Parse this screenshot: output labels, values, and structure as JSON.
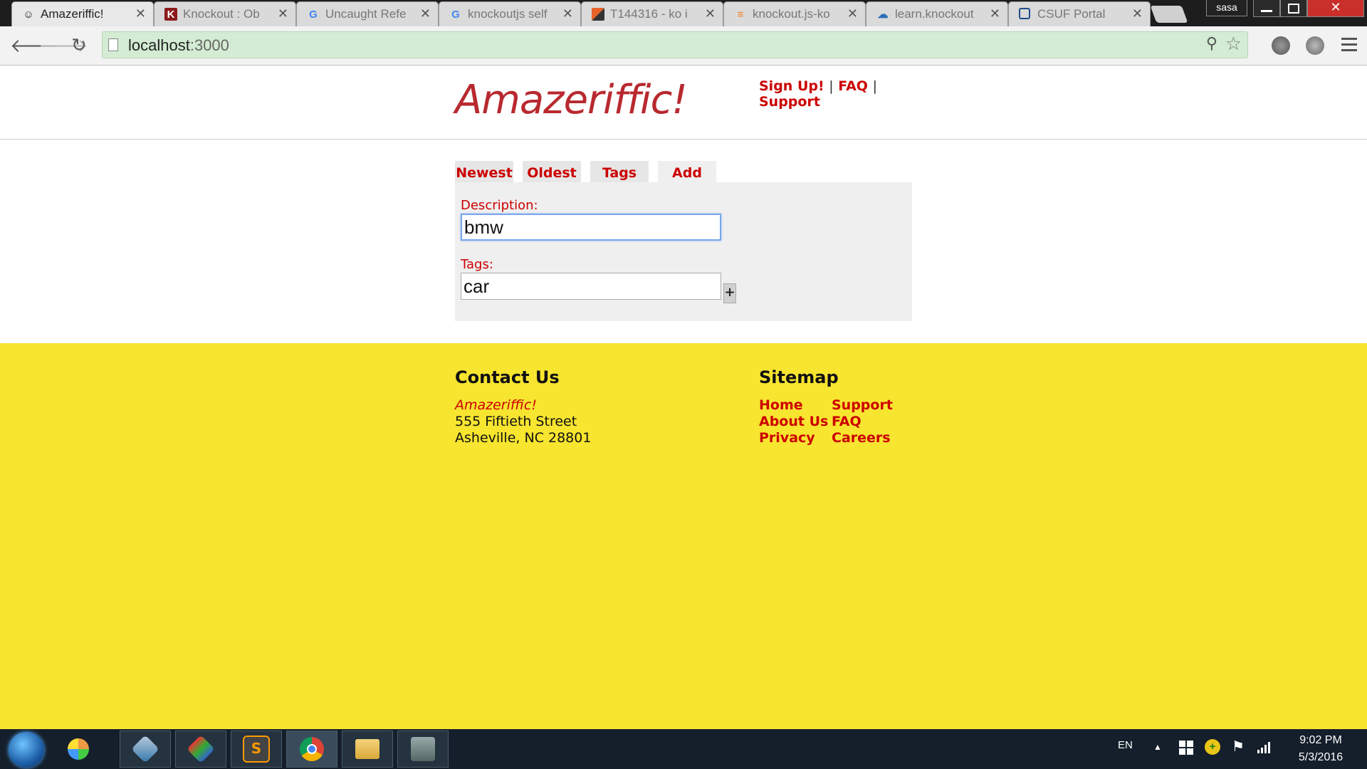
{
  "browser": {
    "tabs": [
      {
        "title": "Amazeriffic!",
        "active": true,
        "icon": "smiley-icon"
      },
      {
        "title": "Knockout : Ob",
        "active": false,
        "icon": "knockout-icon"
      },
      {
        "title": "Uncaught Refe",
        "active": false,
        "icon": "google-icon"
      },
      {
        "title": "knockoutjs self",
        "active": false,
        "icon": "google-icon"
      },
      {
        "title": "T144316 - ko i",
        "active": false,
        "icon": "phabricator-icon"
      },
      {
        "title": "knockout.js-ko",
        "active": false,
        "icon": "stackoverflow-icon"
      },
      {
        "title": "learn.knockout",
        "active": false,
        "icon": "cloud-icon"
      },
      {
        "title": "CSUF Portal",
        "active": false,
        "icon": "portal-icon"
      }
    ],
    "user_badge": "sasa",
    "url_host": "localhost",
    "url_port": ":3000"
  },
  "header": {
    "logo": "Amazeriffic!",
    "nav": {
      "signup": "Sign Up!",
      "sep1": "|",
      "faq": "FAQ",
      "sep2": "|",
      "support": "Support"
    }
  },
  "main": {
    "tabs": [
      "Newest",
      "Oldest",
      "Tags",
      "Add"
    ],
    "description_label": "Description:",
    "description_value": "bmw",
    "tags_label": "Tags:",
    "tags_value": "car",
    "add_tag_button": "+"
  },
  "footer": {
    "contact": {
      "heading": "Contact Us",
      "brand": "Amazeriffic!",
      "street": "555 Fiftieth Street",
      "city": "Asheville, NC 28801"
    },
    "sitemap": {
      "heading": "Sitemap",
      "links": [
        "Home",
        "About Us",
        "Privacy",
        "Support",
        "FAQ",
        "Careers"
      ]
    }
  },
  "taskbar": {
    "language": "EN",
    "time": "9:02 PM",
    "date": "5/3/2016"
  },
  "colors": {
    "brand_red": "#cc0000",
    "logo_red": "#b8292f",
    "footer_yellow": "#f7e52f",
    "omnibox_green": "#d3ecd3"
  }
}
